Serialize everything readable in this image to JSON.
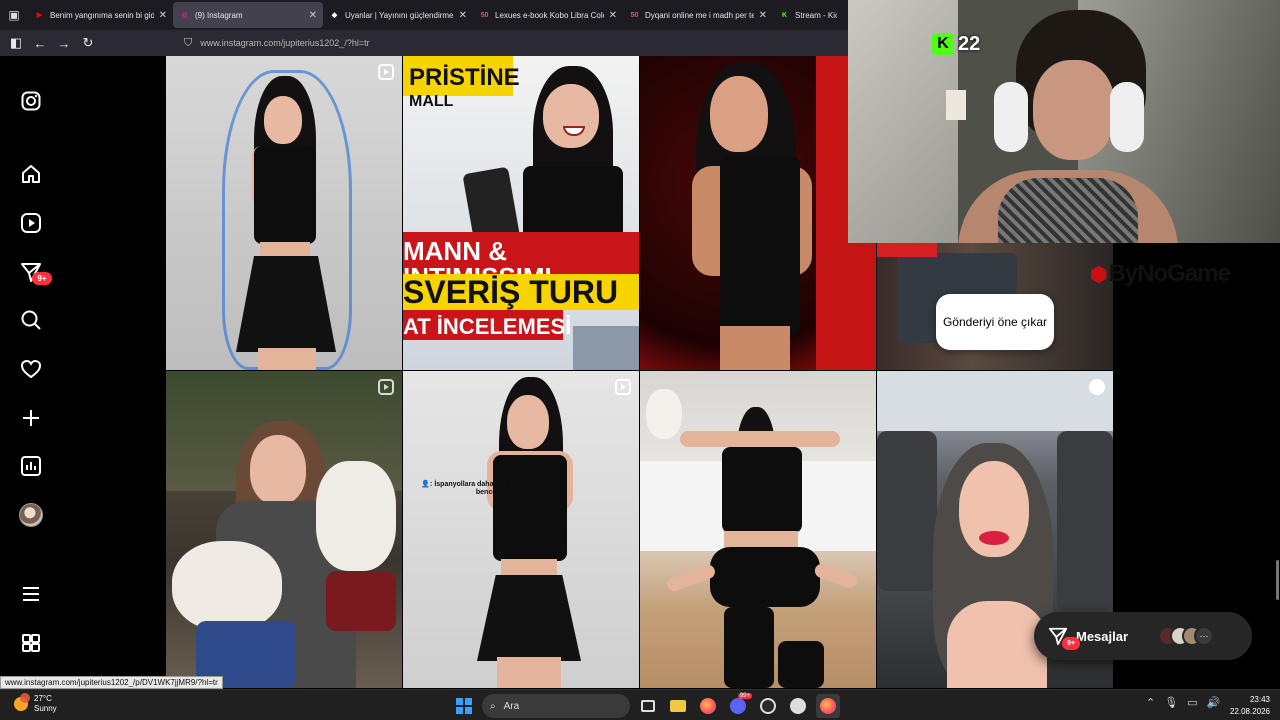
{
  "browser": {
    "tabs": [
      {
        "title": "Benim yangınıma senin bi gidiı",
        "favicon_color": "#ff0000",
        "favicon_glyph": "▶",
        "active": false
      },
      {
        "title": "(9) Instagram",
        "favicon_color": "#d6249f",
        "favicon_glyph": "◎",
        "active": true
      },
      {
        "title": "Uyanlar | Yayınını güçlendirmeli",
        "favicon_color": "#ffffff",
        "favicon_glyph": "◆",
        "active": false
      },
      {
        "title": "Lexues e-book Kobo Libra Colo",
        "favicon_color": "#e55",
        "favicon_glyph": "50",
        "active": false
      },
      {
        "title": "Dyqani online me i madh per te",
        "favicon_color": "#e55",
        "favicon_glyph": "50",
        "active": false
      },
      {
        "title": "Stream - Kick",
        "favicon_color": "#53fc18",
        "favicon_glyph": "K",
        "active": false
      }
    ],
    "close_glyph": "✕",
    "url": "www.instagram.com/jupiterius1202_/?hl=tr"
  },
  "instagram": {
    "nav_badge": "9+",
    "thumbnails": {
      "t2_line1": "PRİSTİNE",
      "t2_line2": "MALL",
      "t2_line3": "MANN & INTIMISSIMI",
      "t2_line4": "SVERİŞ TURU",
      "t2_line5": "AT İNCELEMESİ",
      "t6_caption": "👤: İspanyollara daha çok benziyorsun bence"
    },
    "promote_text": "Gönderiyi öne çıkar",
    "messages_label": "Mesajlar",
    "messages_badge": "9+"
  },
  "overlay": {
    "kick_count": "22",
    "watermark": "ByNoGame"
  },
  "status_url": "www.instagram.com/jupiterius1202_/p/DV1WK7jjMR9/?hl=tr",
  "taskbar": {
    "temperature": "27°C",
    "weather": "Sunny",
    "search_placeholder": "Ara",
    "time": "23:43",
    "date": "22.08.2026",
    "discord_badge": "99+"
  }
}
